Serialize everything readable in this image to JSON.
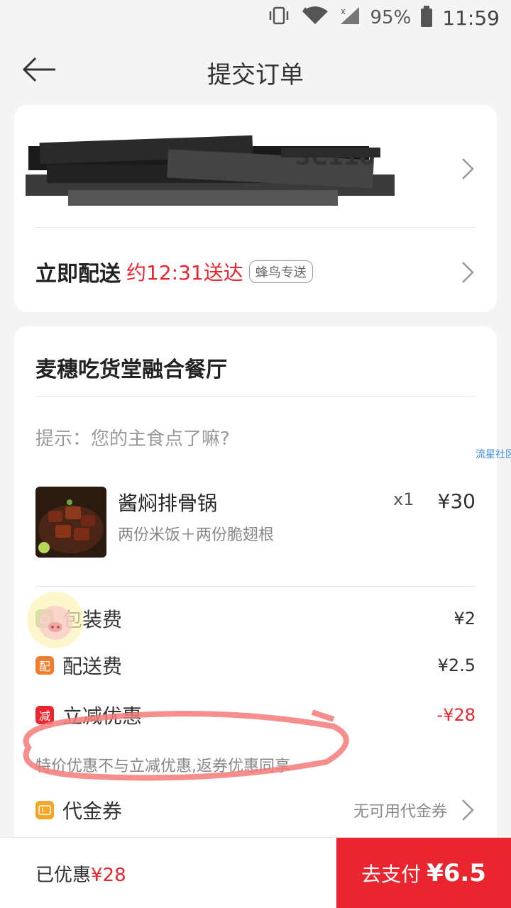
{
  "status_bar": {
    "battery": "95%",
    "time": "11:59"
  },
  "header": {
    "title": "提交订单"
  },
  "address": {
    "visible_fragment": "3C110"
  },
  "delivery": {
    "label": "立即配送",
    "eta": "约12:31送达",
    "badge": "蜂鸟专送"
  },
  "order": {
    "shop_name": "麦穗吃货堂融合餐厅",
    "tip": "提示：您的主食点了嘛?",
    "watermark": "流星社区",
    "items": [
      {
        "name": "酱焖排骨锅",
        "desc": "两份米饭＋两份脆翅根",
        "qty": "x1",
        "price": "¥30"
      }
    ],
    "fees": [
      {
        "icon_text": "",
        "label": "包装费",
        "value": "¥2",
        "color": "#6fb96b"
      },
      {
        "icon_text": "配",
        "label": "配送费",
        "value": "¥2.5",
        "color": "#f27c2e"
      },
      {
        "icon_text": "减",
        "label": "立减优惠",
        "value": "-¥28",
        "color": "#e9262f"
      }
    ],
    "note": "特价优惠不与立减优惠,返券优惠同享",
    "voucher": {
      "icon_text": "卷",
      "label": "代金券",
      "value": "无可用代金券"
    }
  },
  "bottom": {
    "saved_label": "已优惠",
    "saved_amount": "¥28",
    "pay_label": "去支付",
    "pay_amount": "¥6.5"
  },
  "colors": {
    "accent": "#e9262f",
    "background": "#f4f4f4"
  }
}
